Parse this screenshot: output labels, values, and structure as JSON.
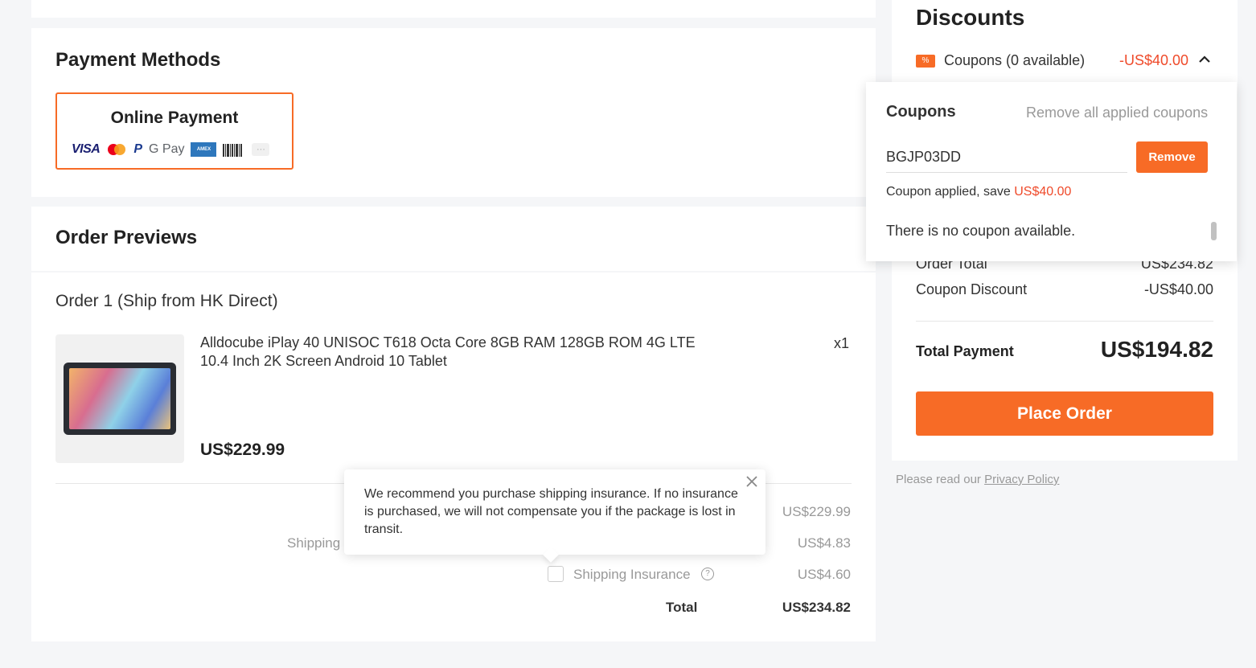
{
  "payment": {
    "title": "Payment Methods",
    "option_label": "Online Payment",
    "icons": [
      "visa-icon",
      "mastercard-icon",
      "paypal-icon",
      "google-pay-icon",
      "amex-icon",
      "boleto-icon",
      "more-icon"
    ],
    "visa_text": "VISA",
    "gpay_text": "G Pay"
  },
  "orders": {
    "title": "Order Previews",
    "order_label": "Order 1 (Ship from HK Direct)",
    "product": {
      "name": "Alldocube iPlay 40 UNISOC T618 Octa Core 8GB RAM 128GB ROM 4G LTE 10.4 Inch 2K Screen Android 10 Tablet",
      "qty": "x1",
      "price": "US$229.99"
    },
    "summary": {
      "subtotal_value": "US$229.99",
      "shipping_label": "Shipping",
      "shipping_value": "US$4.83",
      "insurance_label": "Shipping Insurance",
      "insurance_value": "US$4.60",
      "insurance_checked": false,
      "total_label": "Total",
      "total_value": "US$234.82"
    },
    "tooltip": "We recommend you purchase shipping insurance. If no insurance is purchased, we will not compensate you if the package is lost in transit."
  },
  "discounts": {
    "title": "Discounts",
    "coupons_label": "Coupons (0 available)",
    "coupons_amount": "-US$40.00",
    "order_total_label": "Order Total",
    "order_total_value": "US$234.82",
    "coupon_discount_label": "Coupon Discount",
    "coupon_discount_value": "-US$40.00",
    "total_payment_label": "Total Payment",
    "total_payment_value": "US$194.82",
    "place_order_label": "Place Order",
    "privacy_prefix": "Please read our ",
    "privacy_link": "Privacy Policy"
  },
  "coupon_popup": {
    "title": "Coupons",
    "remove_all": "Remove all applied coupons",
    "code": "BGJP03DD",
    "remove_label": "Remove",
    "applied_prefix": "Coupon applied, save ",
    "applied_amount": "US$40.00",
    "no_coupon": "There is no coupon available."
  },
  "colors": {
    "accent": "#f76b26",
    "discount_red": "#ef4a2a",
    "background": "#f5f6f8"
  }
}
